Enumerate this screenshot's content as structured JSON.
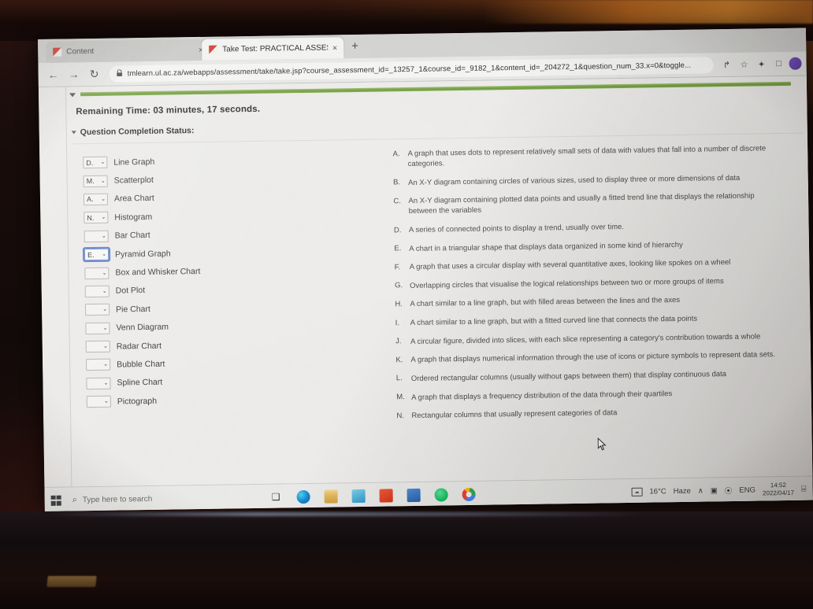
{
  "browser": {
    "tabs": [
      {
        "title": "Content",
        "active": false,
        "close_label": "×"
      },
      {
        "title": "Take Test: PRACTICAL ASSESSME",
        "active": true,
        "close_label": "×"
      }
    ],
    "new_tab_label": "+",
    "back_label": "←",
    "forward_label": "→",
    "reload_label": "↻",
    "lock_label": "🔒",
    "url": "tmlearn.ul.ac.za/webapps/assessment/take/take.jsp?course_assessment_id=_13257_1&course_id=_9182_1&content_id=_204272_1&question_num_33.x=0&toggle...",
    "toolbar_icons": [
      {
        "name": "share-icon",
        "glyph": "↱"
      },
      {
        "name": "bookmark-star-icon",
        "glyph": "☆"
      },
      {
        "name": "extensions-icon",
        "glyph": "✦"
      },
      {
        "name": "sidebar-icon",
        "glyph": "□"
      }
    ]
  },
  "test": {
    "remaining_time": "Remaining Time: 03 minutes, 17 seconds.",
    "question_completion_status": "Question Completion Status:",
    "progress_color": "#7faa4c"
  },
  "matching": {
    "items": [
      {
        "answer": "D.",
        "label": "Line Graph",
        "focused": false
      },
      {
        "answer": "M.",
        "label": "Scatterplot",
        "focused": false
      },
      {
        "answer": "A.",
        "label": "Area Chart",
        "focused": false
      },
      {
        "answer": "N.",
        "label": "Histogram",
        "focused": false
      },
      {
        "answer": "",
        "label": "Bar Chart",
        "focused": false
      },
      {
        "answer": "E.",
        "label": "Pyramid Graph",
        "focused": true
      },
      {
        "answer": "",
        "label": "Box and Whisker Chart",
        "focused": false
      },
      {
        "answer": "",
        "label": "Dot Plot",
        "focused": false
      },
      {
        "answer": "",
        "label": "Pie Chart",
        "focused": false
      },
      {
        "answer": "",
        "label": "Venn Diagram",
        "focused": false
      },
      {
        "answer": "",
        "label": "Radar Chart",
        "focused": false
      },
      {
        "answer": "",
        "label": "Bubble Chart",
        "focused": false
      },
      {
        "answer": "",
        "label": "Spline Chart",
        "focused": false
      },
      {
        "answer": "",
        "label": "Pictograph",
        "focused": false
      }
    ],
    "caret_glyph": "⌄",
    "definitions": [
      {
        "key": "A.",
        "text": "A graph that uses dots to represent relatively small sets of data with values that fall into a number of discrete categories."
      },
      {
        "key": "B.",
        "text": "An X-Y diagram containing circles of various sizes, used to display three or more dimensions of data"
      },
      {
        "key": "C.",
        "text": "An X-Y diagram containing plotted data points and usually a fitted trend line that displays the relationship between the variables"
      },
      {
        "key": "D.",
        "text": "A series of connected points to display a trend, usually over time."
      },
      {
        "key": "E.",
        "text": "A chart in a triangular shape that displays data organized in some kind of hierarchy"
      },
      {
        "key": "F.",
        "text": "A graph that uses a circular display with several quantitative axes, looking like spokes on a wheel"
      },
      {
        "key": "G.",
        "text": "Overlapping circles that visualise the logical relationships between two or more groups of items"
      },
      {
        "key": "H.",
        "text": "A chart similar to a line graph, but with filled areas between the lines and the axes"
      },
      {
        "key": "I.",
        "text": "A chart similar to a line graph, but with a fitted curved line that connects the data points"
      },
      {
        "key": "J.",
        "text": "A circular figure, divided into slices, with each slice representing a category's contribution towards a whole"
      },
      {
        "key": "K.",
        "text": "A graph that displays numerical information through the use of icons or picture symbols to represent data sets."
      },
      {
        "key": "L.",
        "text": "Ordered rectangular columns (usually without gaps between them) that display continuous data"
      },
      {
        "key": "M.",
        "text": "A graph that displays a frequency distribution of the data through their quartiles"
      },
      {
        "key": "N.",
        "text": "Rectangular columns that usually represent categories of data"
      }
    ]
  },
  "taskbar": {
    "search_placeholder": "Type here to search",
    "search_icon": "⌕",
    "task_view_icon": "❑",
    "apps": [
      {
        "name": "edge",
        "cls": "edge"
      },
      {
        "name": "file-explorer",
        "cls": "files"
      },
      {
        "name": "mail",
        "cls": "mail"
      },
      {
        "name": "office",
        "cls": "office"
      },
      {
        "name": "store",
        "cls": "store"
      },
      {
        "name": "spotify",
        "cls": "spotify"
      },
      {
        "name": "chrome",
        "cls": "chrome"
      }
    ],
    "weather_temp": "16°C",
    "weather_condition": "Haze",
    "tray_chevron": "∧",
    "tray_network": "▣",
    "tray_volume": "⦿",
    "tray_language": "ENG",
    "clock_time": "14:52",
    "clock_date": "2022/04/17",
    "notification_icon": "⌸"
  }
}
